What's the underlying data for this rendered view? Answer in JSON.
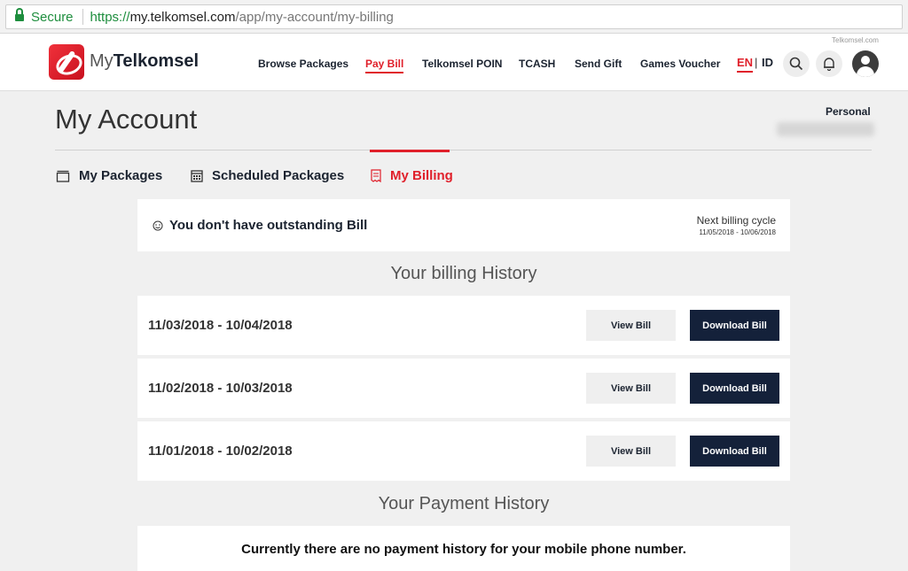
{
  "browser": {
    "secure_label": "Secure",
    "url_scheme": "https://",
    "url_host": "my.telkomsel.com",
    "url_path": "/app/my-account/my-billing"
  },
  "header": {
    "site_small": "Telkomsel.com",
    "brand_my": "My",
    "brand_name": "Telkomsel",
    "nav": [
      {
        "label": "Browse Packages"
      },
      {
        "label": "Pay Bill"
      },
      {
        "label": "Telkomsel POIN"
      },
      {
        "label": "TCASH"
      },
      {
        "label": "Send Gift"
      },
      {
        "label": "Games Voucher"
      }
    ],
    "active_nav": "Pay Bill",
    "lang_en": "EN",
    "lang_sep": "|",
    "lang_id": "ID",
    "icons": [
      "search-icon",
      "bell-icon",
      "avatar-icon"
    ],
    "accent": "#e0202b"
  },
  "account": {
    "title": "My Account",
    "account_type": "Personal",
    "tabs": [
      {
        "label": "My Packages",
        "icon": "package-icon"
      },
      {
        "label": "Scheduled Packages",
        "icon": "calendar-icon"
      },
      {
        "label": "My Billing",
        "icon": "bill-icon"
      }
    ],
    "active_tab": "My Billing"
  },
  "billing": {
    "status": "You don't have outstanding Bill",
    "next_cycle_label": "Next billing cycle",
    "next_cycle_range": "11/05/2018 - 10/06/2018",
    "history_title": "Your billing History",
    "history": [
      {
        "period": "11/03/2018 - 10/04/2018",
        "view_label": "View Bill",
        "download_label": "Download Bill"
      },
      {
        "period": "11/02/2018 - 10/03/2018",
        "view_label": "View Bill",
        "download_label": "Download Bill"
      },
      {
        "period": "11/01/2018 - 10/02/2018",
        "view_label": "View Bill",
        "download_label": "Download Bill"
      }
    ]
  },
  "payment": {
    "history_title": "Your Payment History",
    "empty_message": "Currently there are no payment history for your mobile phone number."
  },
  "colors": {
    "primary_dark": "#14213a",
    "accent_red": "#e0202b",
    "secure_green": "#1e8e3e"
  }
}
